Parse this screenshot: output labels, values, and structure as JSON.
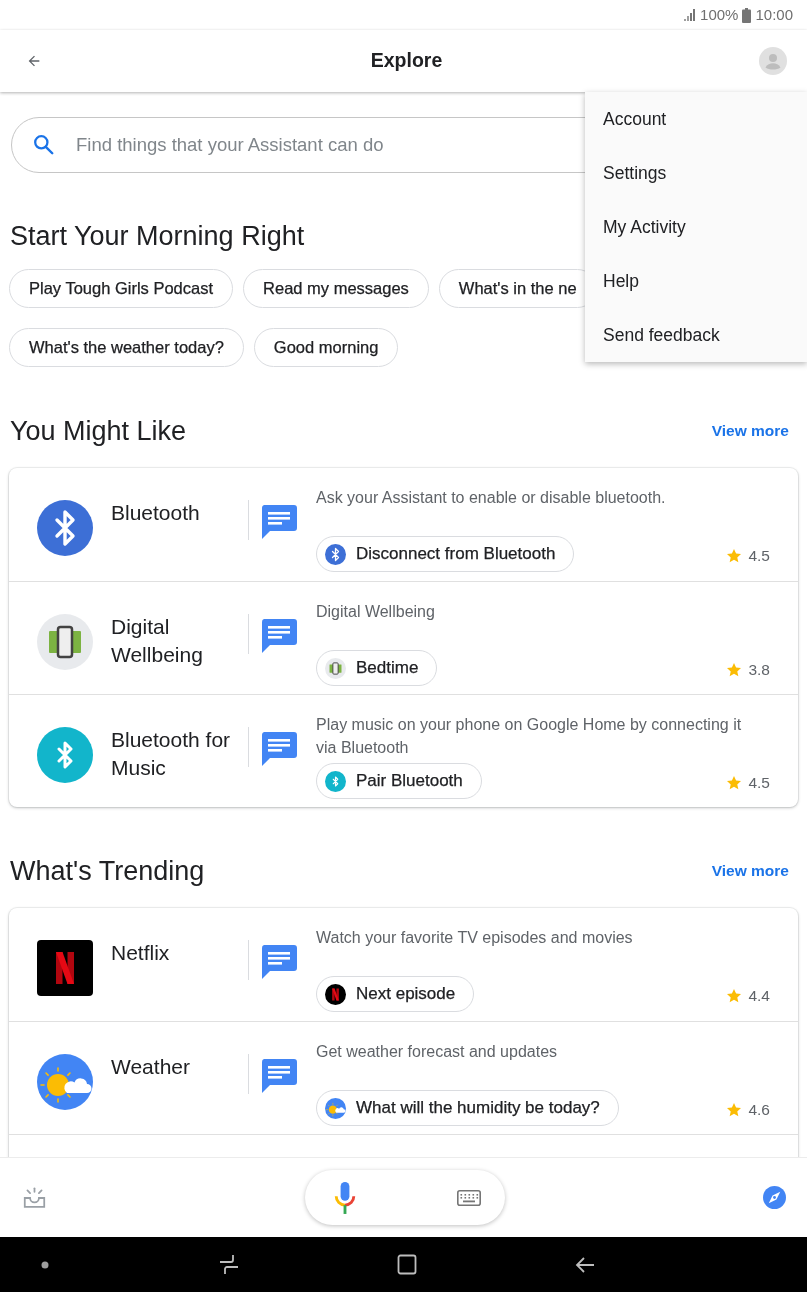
{
  "status_bar": {
    "battery": "100%",
    "time": "10:00"
  },
  "app_bar": {
    "title": "Explore"
  },
  "menu": {
    "items": [
      "Account",
      "Settings",
      "My Activity",
      "Help",
      "Send feedback"
    ]
  },
  "search": {
    "placeholder": "Find things that your Assistant can do"
  },
  "sections": [
    {
      "kind": "chips",
      "title": "Start Your Morning Right",
      "chip_rows": [
        [
          "Play Tough Girls Podcast",
          "Read my messages",
          "What's in the ne"
        ],
        [
          "What's the weather today?",
          "Good morning"
        ]
      ]
    },
    {
      "kind": "cards",
      "title": "You Might Like",
      "link": "View more",
      "items": [
        {
          "kind": "bluetooth",
          "name": "Bluetooth",
          "description": "Ask your Assistant to enable or disable bluetooth.",
          "action": "Disconnect from Bluetooth",
          "rating": "4.5"
        },
        {
          "kind": "wellbeing",
          "name": "Digital Wellbeing",
          "description": "Digital Wellbeing",
          "action": "Bedtime",
          "rating": "3.8"
        },
        {
          "kind": "bluetooth-music",
          "name": "Bluetooth for Music",
          "description": "Play music on your phone on Google Home by connecting it via Bluetooth",
          "action": "Pair Bluetooth",
          "rating": "4.5"
        }
      ]
    },
    {
      "kind": "cards",
      "title": "What's Trending",
      "link": "View more",
      "items": [
        {
          "kind": "netflix",
          "name": "Netflix",
          "description": "Watch your favorite TV episodes and movies",
          "action": "Next episode",
          "rating": "4.4"
        },
        {
          "kind": "weather",
          "name": "Weather",
          "description": "Get weather forecast and updates",
          "action": "What will the humidity be today?",
          "rating": "4.6"
        }
      ]
    }
  ]
}
